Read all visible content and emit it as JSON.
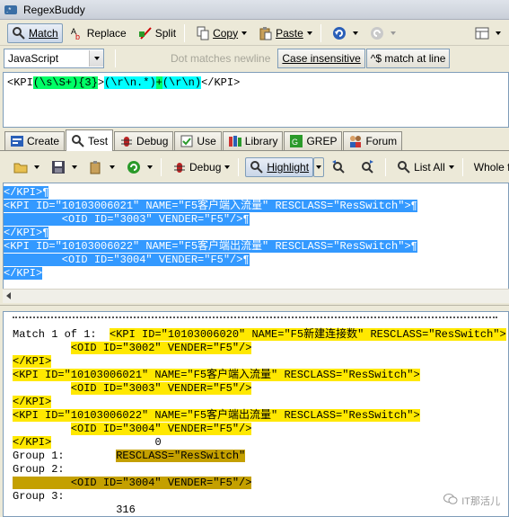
{
  "window": {
    "title": "RegexBuddy"
  },
  "toolbar1": {
    "match": "Match",
    "replace": "Replace",
    "split": "Split",
    "copy": "Copy",
    "paste": "Paste"
  },
  "toolbar2": {
    "flavor": "JavaScript",
    "dot_newline": "Dot matches newline",
    "case_insensitive": "Case insensitive",
    "caret_dollar": "^$ match at line"
  },
  "regex": {
    "p1": "<KPI",
    "g1": "(\\s\\S+)",
    "q1": "{3}",
    "p2": ">",
    "g2": "(\\r\\n.*)",
    "q2": "+",
    "g3": "(\\r\\n)",
    "p3": "</KPI>"
  },
  "tabs": [
    "Create",
    "Test",
    "Debug",
    "Use",
    "Library",
    "GREP",
    "Forum"
  ],
  "toolbar3": {
    "debug": "Debug",
    "highlight": "Highlight",
    "list_all": "List All",
    "whole_file": "Whole file"
  },
  "test_lines": [
    "</KPI>¶",
    "<KPI ID=\"10103006021\" NAME=\"F5客户端入流量\" RESCLASS=\"ResSwitch\">¶",
    "         <OID ID=\"3003\" VENDER=\"F5\"/>¶",
    "</KPI>¶",
    "<KPI ID=\"10103006022\" NAME=\"F5客户端出流量\" RESCLASS=\"ResSwitch\">¶",
    "         <OID ID=\"3004\" VENDER=\"F5\"/>¶",
    "</KPI>"
  ],
  "results": {
    "match_label": "Match 1 of 1:",
    "match_lines": [
      "<KPI ID=\"10103006020\" NAME=\"F5新建连接数\" RESCLASS=\"ResSwitch\">",
      "<OID ID=\"3002\" VENDER=\"F5\"/>",
      "</KPI>",
      "<KPI ID=\"10103006021\" NAME=\"F5客户端入流量\" RESCLASS=\"ResSwitch\">",
      "<OID ID=\"3003\" VENDER=\"F5\"/>",
      "</KPI>",
      "<KPI ID=\"10103006022\" NAME=\"F5客户端出流量\" RESCLASS=\"ResSwitch\">",
      "<OID ID=\"3004\" VENDER=\"F5\"/>",
      "</KPI>"
    ],
    "match_pos": "0",
    "group1_label": "Group 1:",
    "group1_value": "RESCLASS=\"ResSwitch\"",
    "group2_label": "Group 2:",
    "group2_value": "<OID ID=\"3004\" VENDER=\"F5\"/>",
    "group3_label": "Group 3:",
    "group3_value": "316"
  },
  "watermark": "IT那活儿"
}
